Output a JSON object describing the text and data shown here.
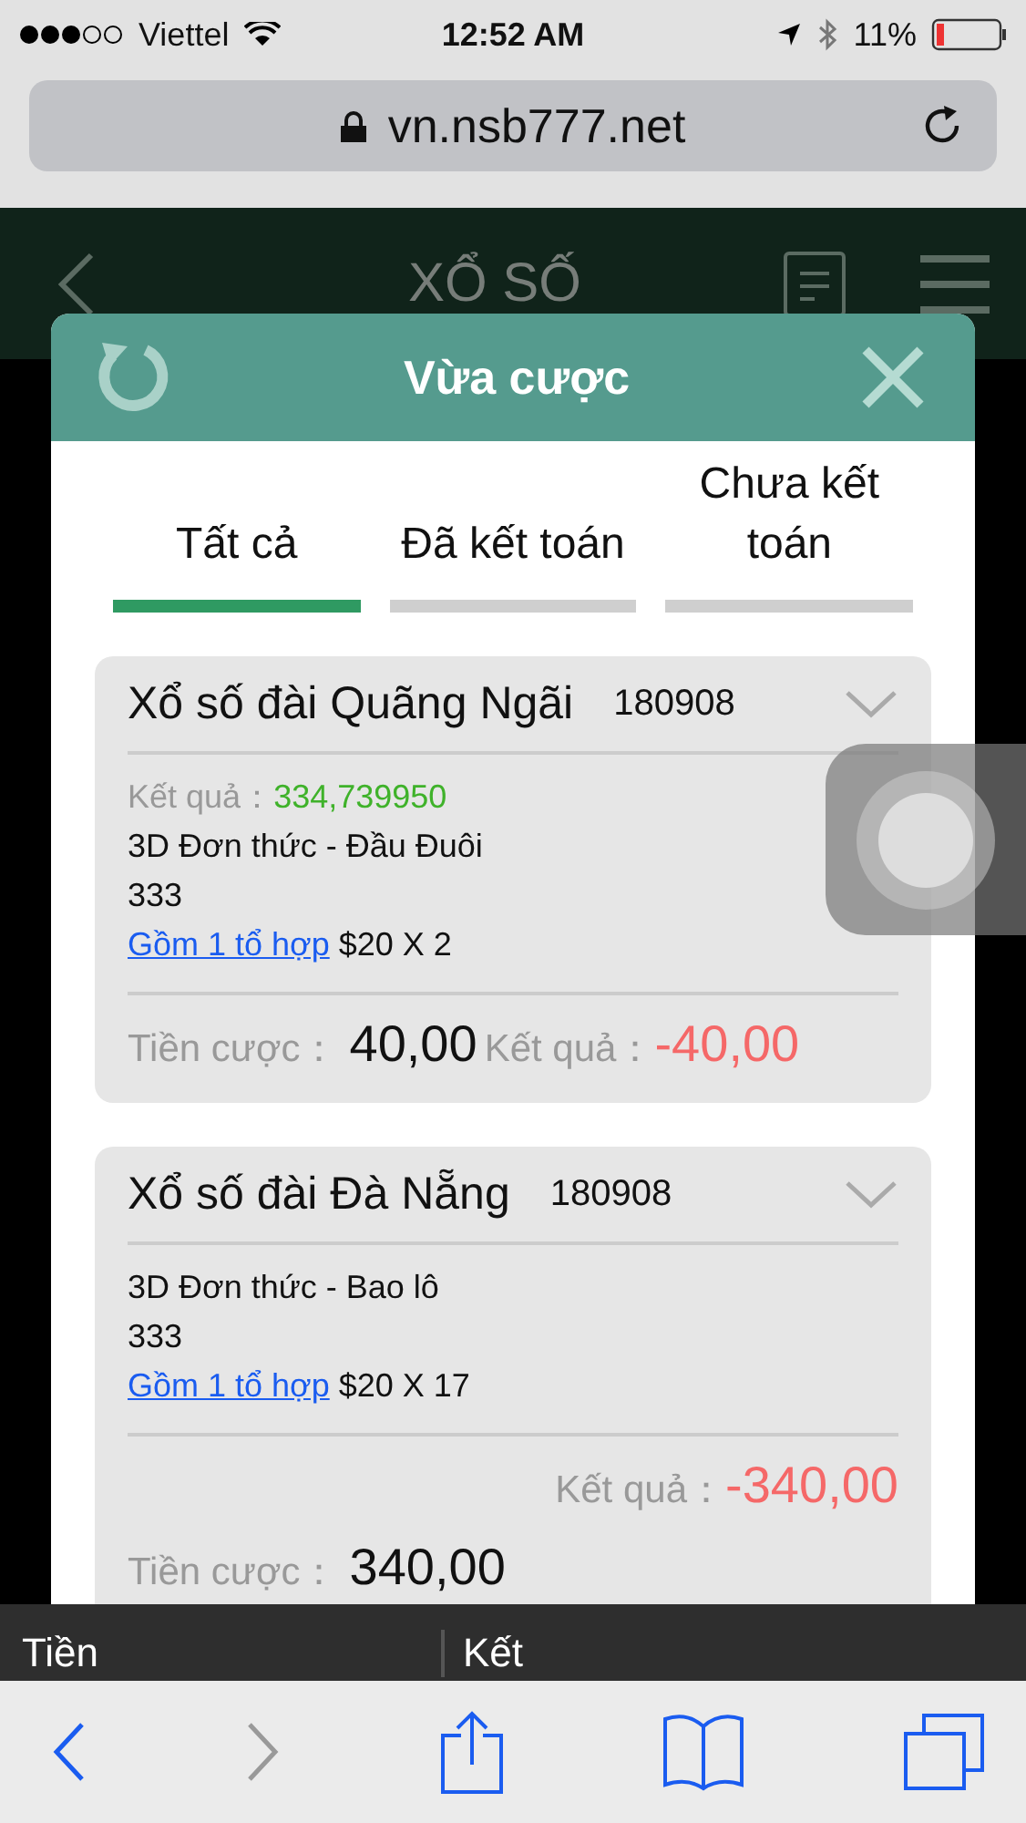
{
  "status_bar": {
    "carrier": "Viettel",
    "time": "12:52 AM",
    "battery": "11%"
  },
  "address_bar": {
    "url": "vn.nsb777.net"
  },
  "app_header": {
    "title": "XỔ SỐ"
  },
  "modal": {
    "title": "Vừa cược",
    "tabs": [
      {
        "label": "Tất cả",
        "selected": true
      },
      {
        "label": "Đã kết toán",
        "selected": false
      },
      {
        "label": "Chưa kết toán",
        "selected": false
      }
    ],
    "bets": [
      {
        "lottery": "Xổ số đài Quãng Ngãi",
        "draw": "180908",
        "draw_result_label": "Kết quả：",
        "draw_result": "334,739950",
        "bet_type": "3D Đơn thức - Đầu Đuôi",
        "numbers": "333",
        "combo_link": "Gồm 1 tổ hợp",
        "stake_detail": "$20 X 2",
        "kind": "inline",
        "stake_label": "Tiền cược：",
        "stake": "40,00",
        "result_label": "Kết quả：",
        "result": "-40,00"
      },
      {
        "lottery": "Xổ số đài Đà Nẵng",
        "draw": "180908",
        "bet_type": "3D Đơn thức - Bao lô",
        "numbers": "333",
        "combo_link": "Gồm 1 tổ hợp",
        "stake_detail": "$20 X 17",
        "kind": "stacked",
        "stake_label": "Tiền cược：",
        "stake": "340,00",
        "result_label": "Kết quả：",
        "result": "-340,00"
      }
    ]
  },
  "background_table": {
    "column_1": "Tiền",
    "column_2": "Kết"
  }
}
